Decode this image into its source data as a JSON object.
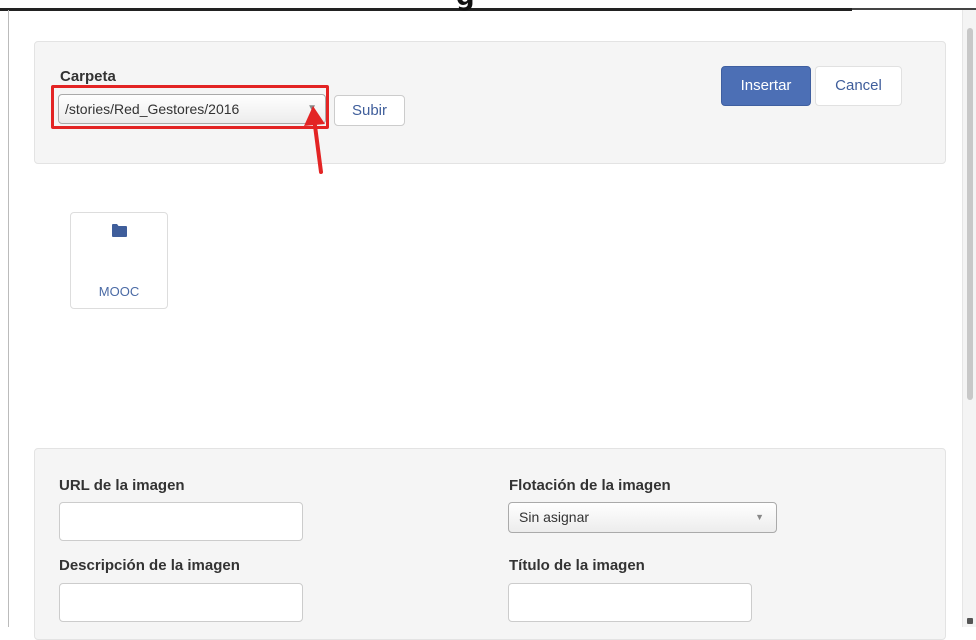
{
  "header": {
    "title_glyph": "g"
  },
  "toolbar": {
    "folder_label": "Carpeta",
    "folder_value": "/stories/Red_Gestores/2016",
    "upload_label": "Subir",
    "insert_label": "Insertar",
    "cancel_label": "Cancel"
  },
  "folders": [
    {
      "name": "MOOC",
      "icon": "folder-icon"
    }
  ],
  "form": {
    "url_label": "URL de la imagen",
    "url_value": "",
    "float_label": "Flotación de la imagen",
    "float_value": "Sin asignar",
    "description_label": "Descripción de la imagen",
    "description_value": "",
    "title_label": "Título de la imagen",
    "title_value": ""
  },
  "colors": {
    "accent": "#4c6fb5",
    "link": "#3f5e9b",
    "highlight": "#e32424"
  }
}
